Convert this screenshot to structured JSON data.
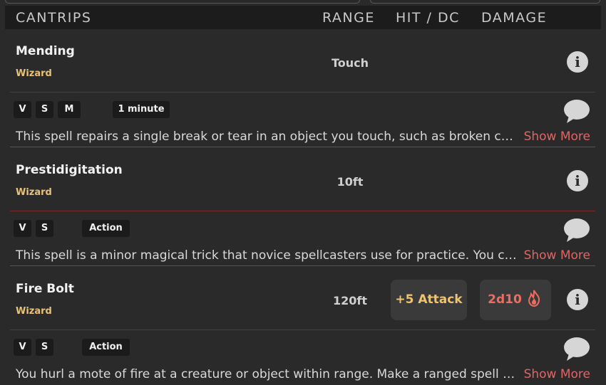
{
  "header": {
    "section_label": "CANTRIPS",
    "range_label": "RANGE",
    "hit_label": "HIT / DC",
    "damage_label": "DAMAGE"
  },
  "spells": [
    {
      "name": "Mending",
      "class": "Wizard",
      "range": "Touch",
      "components": [
        "V",
        "S",
        "M"
      ],
      "casting_time": "1 minute",
      "description": "This spell repairs a single break or tear in an object you touch, such as broken ch...",
      "show_more": "Show More"
    },
    {
      "name": "Prestidigitation",
      "class": "Wizard",
      "range": "10ft",
      "components": [
        "V",
        "S"
      ],
      "casting_time": "Action",
      "description": "This spell is a minor magical trick that novice spellcasters use for practice. You cr...",
      "show_more": "Show More"
    },
    {
      "name": "Fire Bolt",
      "class": "Wizard",
      "range": "120ft",
      "components": [
        "V",
        "S"
      ],
      "casting_time": "Action",
      "hit": "+5 Attack",
      "damage": "2d10",
      "description": "You hurl a mote of fire at a creature or object within range. Make a ranged spell at...",
      "show_more": "Show More"
    }
  ],
  "icons": {
    "info": "info-icon",
    "note": "note-speech-bubble-icon",
    "fire": "fire-damage-icon"
  },
  "colors": {
    "class_text": "#e8c27a",
    "show_more": "#e06565",
    "attack": "#f0c46c",
    "damage": "#ef6c62",
    "divider": "#7a2a2a"
  }
}
